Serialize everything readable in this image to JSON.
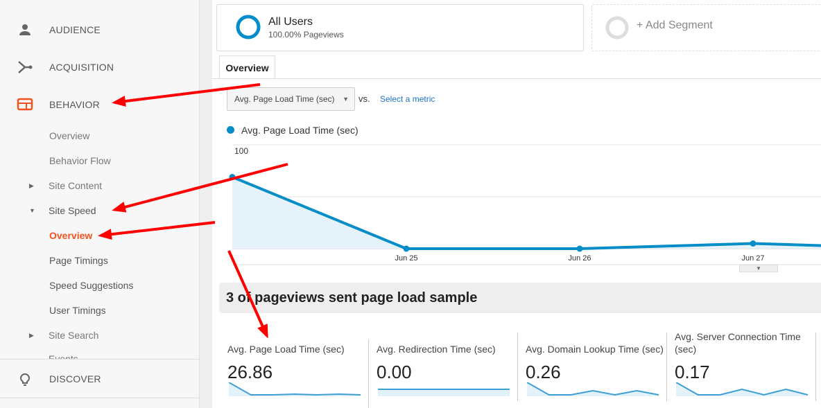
{
  "sidebar": {
    "items": [
      {
        "label": "AUDIENCE",
        "icon": "person-icon"
      },
      {
        "label": "ACQUISITION",
        "icon": "acquisition-icon"
      },
      {
        "label": "BEHAVIOR",
        "icon": "behavior-icon"
      }
    ],
    "behavior_sub": [
      "Overview",
      "Behavior Flow",
      "Site Content",
      "Site Speed"
    ],
    "site_speed_sub": [
      "Overview",
      "Page Timings",
      "Speed Suggestions",
      "User Timings"
    ],
    "more": [
      "Site Search",
      "Events"
    ],
    "discover": "DISCOVER",
    "accent": "#f4511e"
  },
  "segments": {
    "all_users": "All Users",
    "all_users_sub": "100.00% Pageviews",
    "add": "+ Add Segment"
  },
  "tabs": {
    "overview": "Overview"
  },
  "metric_select": {
    "value": "Avg. Page Load Time (sec)",
    "vs": "vs.",
    "select": "Select a metric"
  },
  "chart_data": {
    "type": "area",
    "series": [
      {
        "name": "Avg. Page Load Time (sec)",
        "values": [
          69,
          0,
          0,
          5,
          3
        ]
      }
    ],
    "x": [
      "",
      "Jun 25",
      "Jun 26",
      "Jun 27",
      ""
    ],
    "y_ticks": [
      "100",
      "50"
    ],
    "ylim": [
      0,
      100
    ],
    "color": "#058dc7",
    "grid": true,
    "legend": "top-left"
  },
  "sample_banner": "3 of pageviews sent page load sample",
  "kpis": [
    {
      "title": "Avg. Page Load Time (sec)",
      "value": "26.86",
      "spark": [
        10,
        1,
        1,
        1.5,
        1,
        1.5,
        1
      ]
    },
    {
      "title": "Avg. Redirection Time (sec)",
      "value": "0.00",
      "spark": [
        0,
        0,
        0,
        0,
        0,
        0,
        0
      ]
    },
    {
      "title": "Avg. Domain Lookup Time (sec)",
      "value": "0.26",
      "spark": [
        10,
        1,
        1,
        4,
        1,
        4,
        1
      ]
    },
    {
      "title": "Avg. Server Connection Time (sec)",
      "value": "0.17",
      "spark": [
        10,
        1,
        1,
        5,
        1,
        5,
        1
      ]
    }
  ]
}
